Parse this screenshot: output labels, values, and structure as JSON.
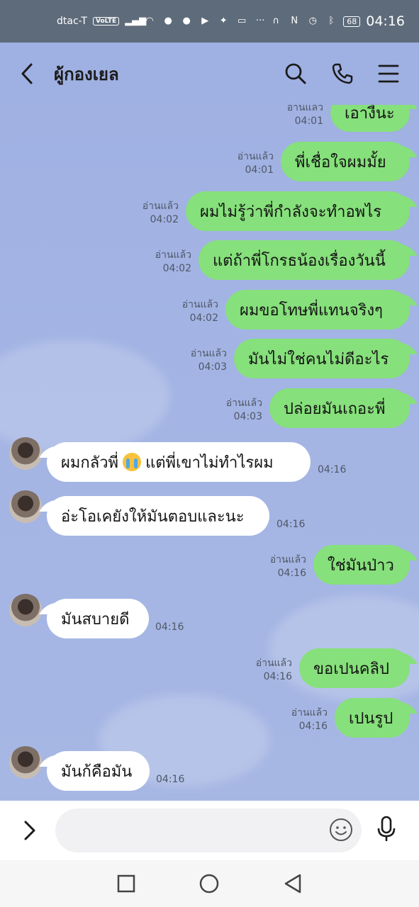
{
  "status_bar": {
    "carrier": "dtac-T",
    "volte": "VoLTE",
    "battery": "68",
    "time": "04:16"
  },
  "header": {
    "title": "ผู้กองเยล",
    "icons": [
      "back-icon",
      "search-icon",
      "phone-icon",
      "menu-icon"
    ]
  },
  "messages": [
    {
      "dir": "out",
      "text": "เอางี้นะ",
      "read": "อานแลว",
      "time": "04:01"
    },
    {
      "dir": "out",
      "text": "พี่เชื่อใจผมมั้ย",
      "read": "อ่านแล้ว",
      "time": "04:01"
    },
    {
      "dir": "out",
      "text": "ผมไม่รู้ว่าพี่กำลังจะทำอพไร",
      "read": "อ่านแล้ว",
      "time": "04:02"
    },
    {
      "dir": "out",
      "text": "แต่ถ้าพี่โกรธน้องเรื่องวันนี้",
      "read": "อ่านแล้ว",
      "time": "04:02"
    },
    {
      "dir": "out",
      "text": "ผมขอโทษพี่แทนจริงๆ",
      "read": "อ่านแล้ว",
      "time": "04:02"
    },
    {
      "dir": "out",
      "text": "มันไม่ใช่คนไม่ดีอะไร",
      "read": "อ่านแล้ว",
      "time": "04:03"
    },
    {
      "dir": "out",
      "text": "ปล่อยมันเถอะพี่",
      "read": "อ่านแล้ว",
      "time": "04:03"
    },
    {
      "dir": "in",
      "text_before": "ผมกลัวพี่",
      "emoji": "crying-face-icon",
      "text_after": "แต่พี่เขาไม่ทำไรผม",
      "time": "04:16"
    },
    {
      "dir": "in",
      "text": "อ่ะโอเคยังให้มันตอบและนะ",
      "time": "04:16"
    },
    {
      "dir": "out",
      "text": "ใช่มันป่าว",
      "read": "อ่านแล้ว",
      "time": "04:16"
    },
    {
      "dir": "in",
      "text": "มันสบายดี",
      "time": "04:16"
    },
    {
      "dir": "out",
      "text": "ขอเปนคลิป",
      "read": "อ่านแล้ว",
      "time": "04:16"
    },
    {
      "dir": "out",
      "text": "เปนรูป",
      "read": "อ่านแล้ว",
      "time": "04:16"
    },
    {
      "dir": "in",
      "text": "มันก้คือมัน",
      "time": "04:16"
    }
  ],
  "input": {
    "placeholder": ""
  },
  "colors": {
    "chat_background": "#a3b4e4",
    "outgoing_bubble": "#86e07b",
    "incoming_bubble": "#ffffff",
    "status_bar": "#5e6b7a"
  }
}
